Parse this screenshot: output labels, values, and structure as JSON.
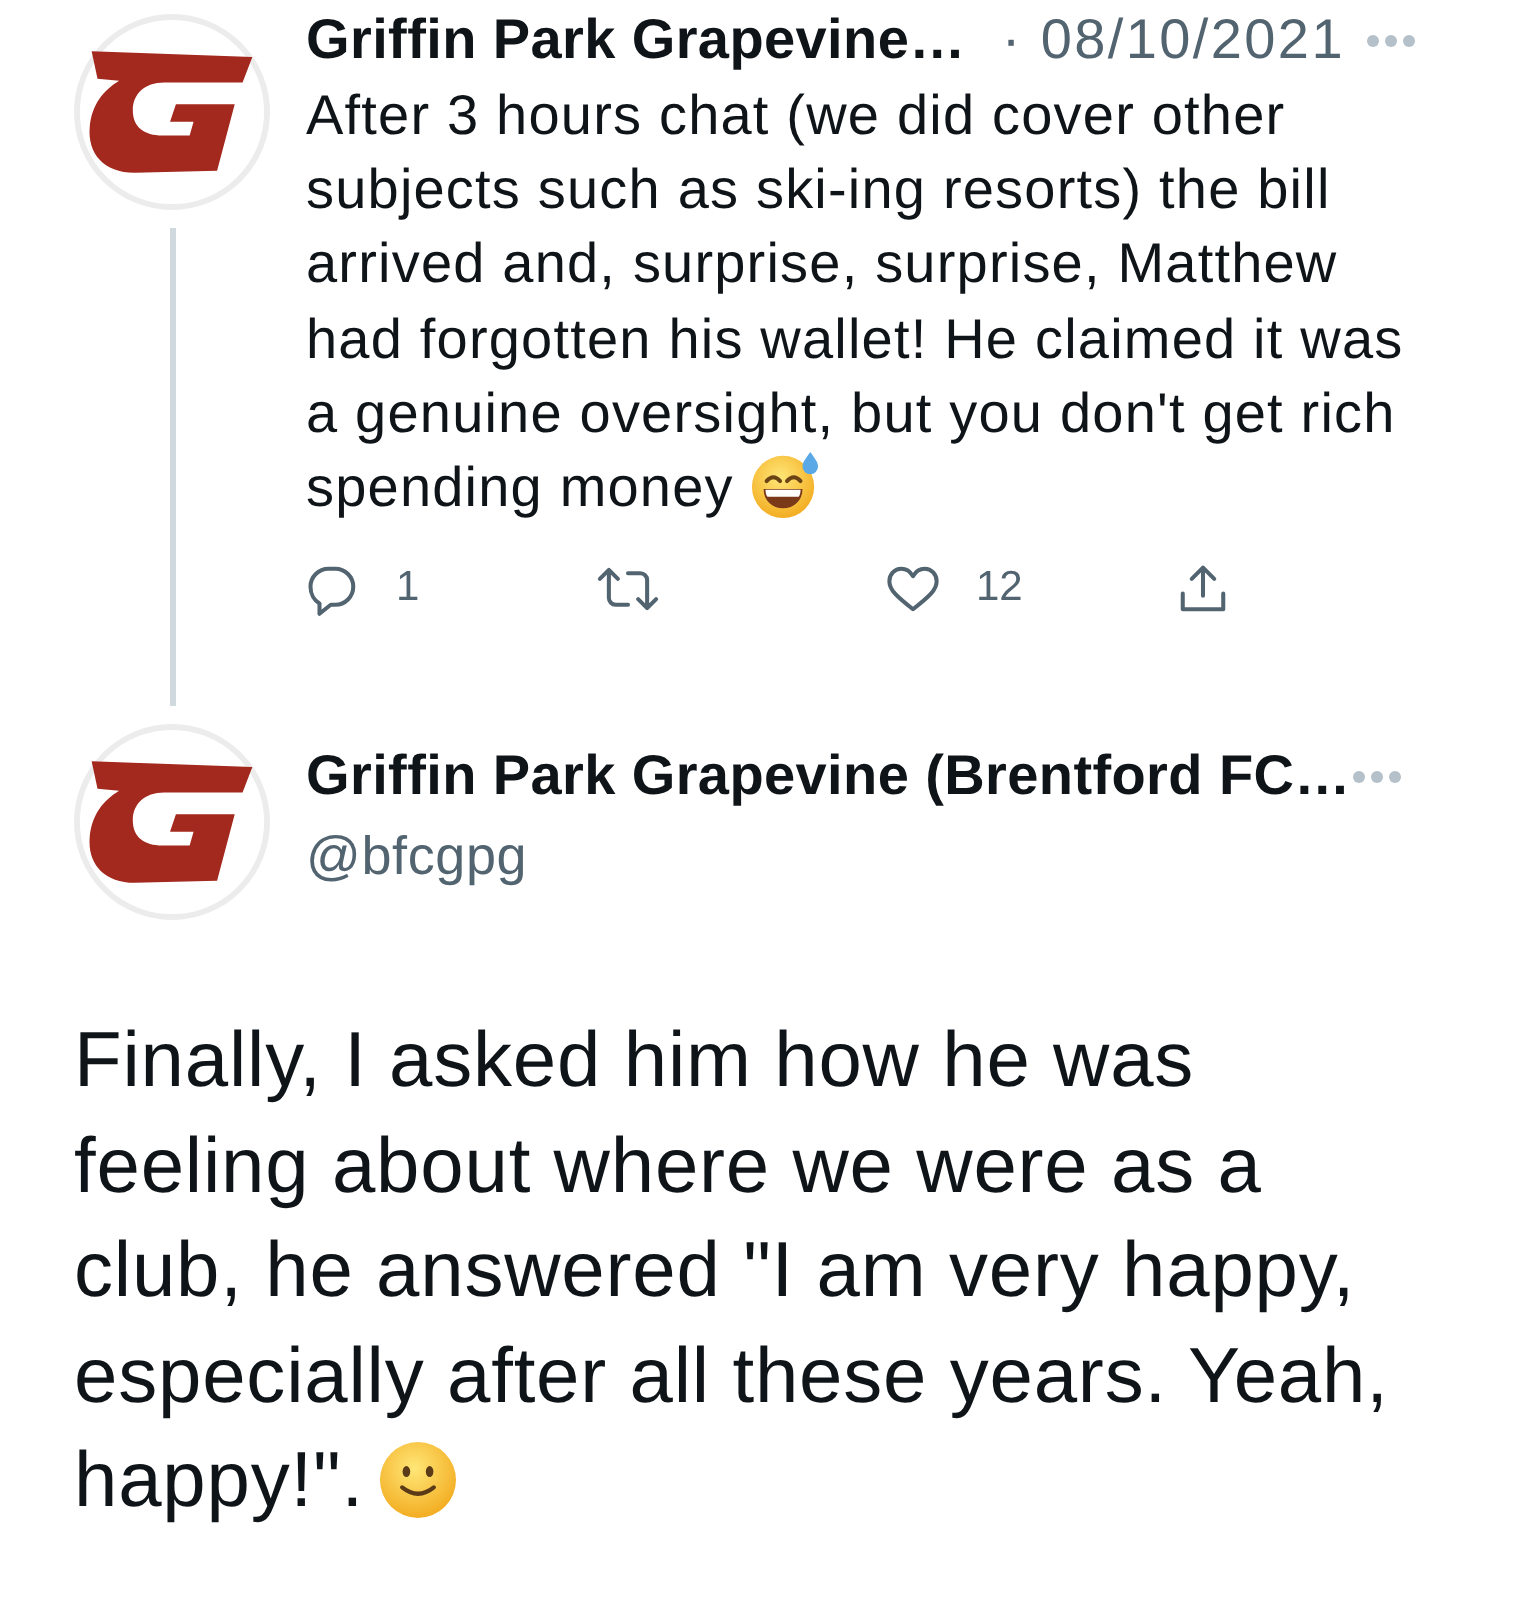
{
  "tweets": [
    {
      "kind": "thread_parent",
      "name": "Griffin Park Grapevine…",
      "date": "· 08/10/2021",
      "text": "After 3 hours chat (we did cover other subjects such as ski-ing resorts) the bill arrived and, surprise, surprise, Matthew had forgotten his wallet! He claimed it was a genuine oversight, but you don't get rich spending money",
      "actions": [
        {
          "kind": "reply",
          "count": "1"
        },
        {
          "kind": "retweet"
        },
        {
          "kind": "like",
          "count": "12"
        },
        {
          "kind": "share"
        }
      ]
    },
    {
      "kind": "focused",
      "name": "Griffin Park Grapevine (Brentford FC…",
      "handle": "@bfcgpg",
      "text": "Finally, I asked him how he was feeling about where we were as a club, he answered \"I am very happy, especially after all these years. Yeah, happy!\"."
    }
  ]
}
